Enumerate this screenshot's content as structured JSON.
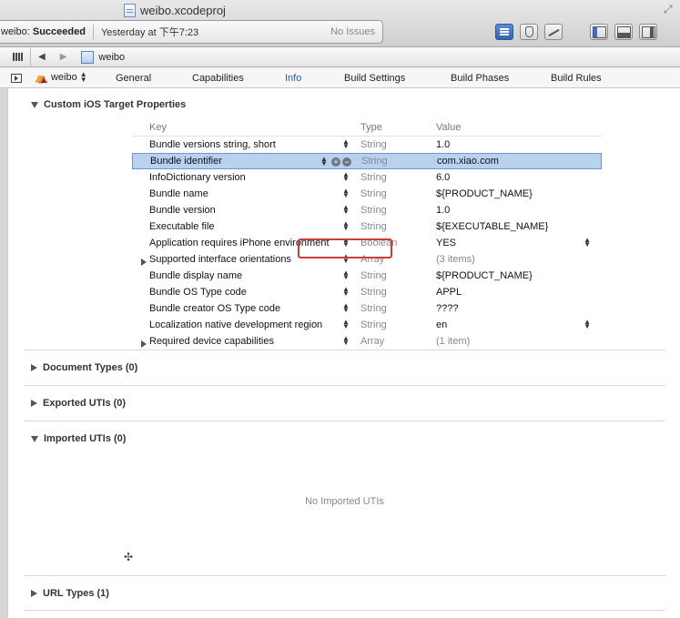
{
  "window": {
    "title": "weibo.xcodeproj",
    "status_project": "weibo:",
    "status_state": "Succeeded",
    "status_time": "Yesterday at 下午7:23",
    "issues": "No Issues"
  },
  "jumpbar": {
    "project": "weibo"
  },
  "editor": {
    "target": "weibo",
    "tabs": [
      "General",
      "Capabilities",
      "Info",
      "Build Settings",
      "Build Phases",
      "Build Rules"
    ],
    "active_tab": "Info"
  },
  "sections": {
    "custom": "Custom iOS Target Properties",
    "document_types": "Document Types (0)",
    "exported_utis": "Exported UTIs (0)",
    "imported_utis": "Imported UTIs (0)",
    "imported_empty": "No Imported UTIs",
    "url_types": "URL Types (1)"
  },
  "plist": {
    "headers": {
      "key": "Key",
      "type": "Type",
      "value": "Value"
    },
    "rows": [
      {
        "key": "Bundle versions string, short",
        "type": "String",
        "value": "1.0"
      },
      {
        "key": "Bundle identifier",
        "type": "String",
        "value": "com.xiao.com"
      },
      {
        "key": "InfoDictionary version",
        "type": "String",
        "value": "6.0"
      },
      {
        "key": "Bundle name",
        "type": "String",
        "value": "${PRODUCT_NAME}"
      },
      {
        "key": "Bundle version",
        "type": "String",
        "value": "1.0"
      },
      {
        "key": "Executable file",
        "type": "String",
        "value": "${EXECUTABLE_NAME}"
      },
      {
        "key": "Application requires iPhone environment",
        "type": "Boolean",
        "value": "YES"
      },
      {
        "key": "Supported interface orientations",
        "type": "Array",
        "value": "(3 items)"
      },
      {
        "key": "Bundle display name",
        "type": "String",
        "value": "${PRODUCT_NAME}"
      },
      {
        "key": "Bundle OS Type code",
        "type": "String",
        "value": "APPL"
      },
      {
        "key": "Bundle creator OS Type code",
        "type": "String",
        "value": "????"
      },
      {
        "key": "Localization native development region",
        "type": "String",
        "value": "en"
      },
      {
        "key": "Required device capabilities",
        "type": "Array",
        "value": "(1 item)"
      }
    ]
  },
  "icons": {
    "add": "+",
    "remove": "−",
    "add_row": "✣"
  },
  "colors": {
    "accent": "#2463b6",
    "selection": "#b8d1ef",
    "annotation": "#d23b3b"
  }
}
